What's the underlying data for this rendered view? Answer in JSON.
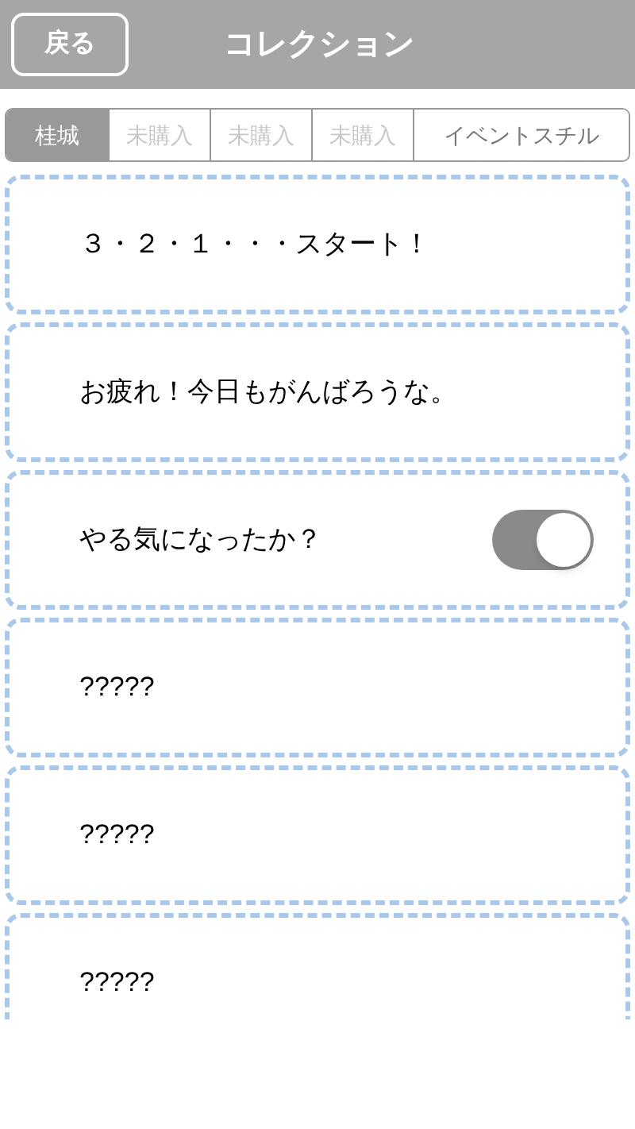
{
  "header": {
    "back_button": "戻る",
    "title": "コレクション"
  },
  "tabs": [
    {
      "label": "桂城",
      "selected": true,
      "disabled": false
    },
    {
      "label": "未購入",
      "selected": false,
      "disabled": true
    },
    {
      "label": "未購入",
      "selected": false,
      "disabled": true
    },
    {
      "label": "未購入",
      "selected": false,
      "disabled": true
    },
    {
      "label": "イベントスチル",
      "selected": false,
      "disabled": false
    }
  ],
  "items": [
    {
      "kind": "text",
      "text": "３・２・１・・・スタート！"
    },
    {
      "kind": "text",
      "text": "お疲れ！今日もがんばろうな。"
    },
    {
      "kind": "toggle",
      "text": "やる気になったか？",
      "on": true
    },
    {
      "kind": "text",
      "text": "?????"
    },
    {
      "kind": "text",
      "text": "?????"
    },
    {
      "kind": "text",
      "text": "?????"
    }
  ]
}
